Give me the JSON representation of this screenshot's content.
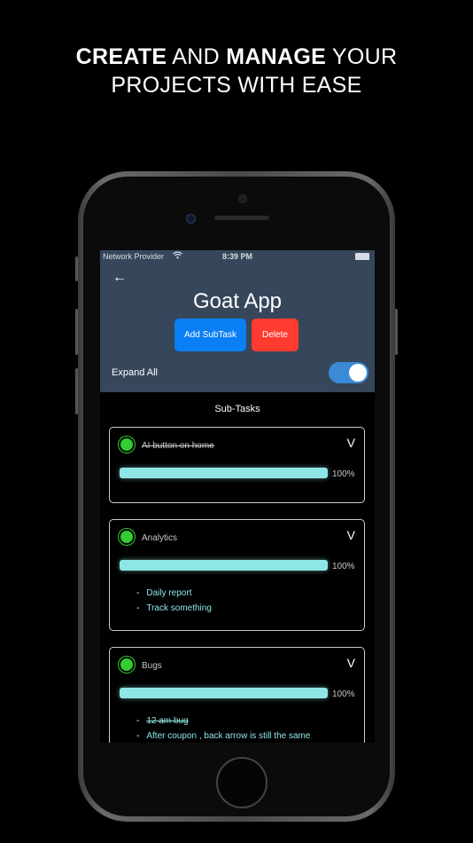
{
  "headline": {
    "line1_bold_a": "CREATE",
    "line1_mid": " AND ",
    "line1_bold_b": "MANAGE",
    "line1_end": " YOUR",
    "line2": "PROJECTS WITH EASE"
  },
  "status_bar": {
    "carrier": "Network Provider",
    "time": "8:39 PM"
  },
  "header": {
    "back_icon": "←",
    "title": "Goat App",
    "add_label": "Add SubTask",
    "delete_label": "Delete",
    "expand_label": "Expand All",
    "expand_all": true
  },
  "subtasks_title": "Sub-Tasks",
  "cards": [
    {
      "title": "AI button on home",
      "done": true,
      "percent": "100%",
      "progress": 1.0,
      "items": []
    },
    {
      "title": "Analytics",
      "done": false,
      "percent": "100%",
      "progress": 1.0,
      "items": [
        {
          "text": "Daily report",
          "done": true
        },
        {
          "text": "Track something",
          "done": false
        }
      ]
    },
    {
      "title": "Bugs",
      "done": false,
      "percent": "100%",
      "progress": 1.0,
      "items": [
        {
          "text": "12 am bug",
          "done": true
        },
        {
          "text": "After coupon , back arrow is still the same",
          "done": true
        }
      ]
    }
  ],
  "colors": {
    "header_bg": "#36475b",
    "add_button": "#0a7ff5",
    "delete_button": "#ff3b30",
    "progress": "#8fe6e6",
    "status_dot": "#33cc33",
    "toggle_on": "#3a8ad6"
  }
}
